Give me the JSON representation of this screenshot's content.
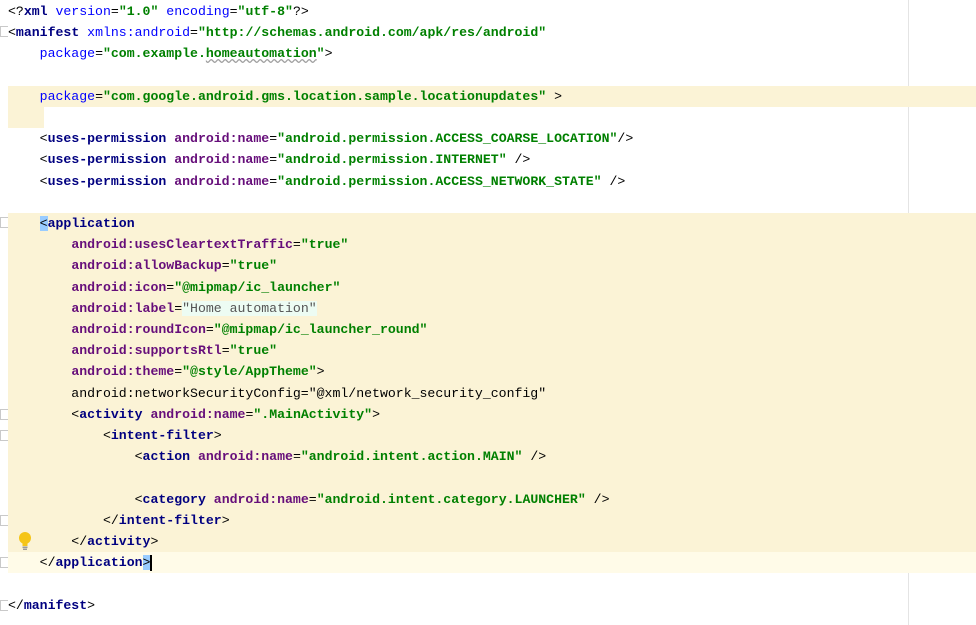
{
  "editor": {
    "lines": [
      {
        "id": "l1",
        "parts": [
          [
            "p",
            "<?"
          ],
          [
            "t",
            "xml "
          ],
          [
            "a",
            "version"
          ],
          [
            "p",
            "="
          ],
          [
            "v",
            "\"1.0\" "
          ],
          [
            "a",
            "encoding"
          ],
          [
            "p",
            "="
          ],
          [
            "v",
            "\"utf-8\""
          ],
          [
            "p",
            "?>"
          ]
        ]
      },
      {
        "id": "l2",
        "parts": [
          [
            "p",
            "<"
          ],
          [
            "t",
            "manifest "
          ],
          [
            "a",
            "xmlns:"
          ],
          [
            "a",
            "android"
          ],
          [
            "p",
            "="
          ],
          [
            "v",
            "\"http://schemas.android.com/apk/res/android\""
          ]
        ]
      },
      {
        "id": "l3",
        "parts": [
          [
            "p",
            "    "
          ],
          [
            "a",
            "package"
          ],
          [
            "p",
            "="
          ],
          [
            "v",
            "\"com.example."
          ],
          [
            "v",
            "homeautomation"
          ],
          [
            "v",
            "\""
          ],
          [
            "p",
            ">"
          ]
        ]
      },
      {
        "id": "l4",
        "parts": []
      },
      {
        "id": "l5",
        "parts": [
          [
            "p",
            "    "
          ],
          [
            "a",
            "package"
          ],
          [
            "p",
            "="
          ],
          [
            "v",
            "\"com.google.android.gms.location.sample."
          ],
          [
            "v",
            "locationupdates"
          ],
          [
            "v",
            "\""
          ],
          [
            "p",
            " >"
          ]
        ]
      },
      {
        "id": "l6",
        "parts": []
      },
      {
        "id": "l7",
        "parts": [
          [
            "p",
            "    <"
          ],
          [
            "t",
            "uses-permission "
          ],
          [
            "aa",
            "android"
          ],
          [
            "an",
            ":name"
          ],
          [
            "p",
            "="
          ],
          [
            "v",
            "\"android.permission.ACCESS_COARSE_LOCATION\""
          ],
          [
            "p",
            "/>"
          ]
        ]
      },
      {
        "id": "l8",
        "parts": [
          [
            "p",
            "    <"
          ],
          [
            "t",
            "uses-permission "
          ],
          [
            "aa",
            "android"
          ],
          [
            "an",
            ":name"
          ],
          [
            "p",
            "="
          ],
          [
            "v",
            "\"android.permission.INTERNET\""
          ],
          [
            "p",
            " />"
          ]
        ]
      },
      {
        "id": "l9",
        "parts": [
          [
            "p",
            "    <"
          ],
          [
            "t",
            "uses-permission "
          ],
          [
            "aa",
            "android"
          ],
          [
            "an",
            ":name"
          ],
          [
            "p",
            "="
          ],
          [
            "v",
            "\"android.permission.ACCESS_NETWORK_STATE\""
          ],
          [
            "p",
            " />"
          ]
        ]
      },
      {
        "id": "l10",
        "parts": []
      },
      {
        "id": "l11",
        "parts": [
          [
            "p",
            "    "
          ],
          [
            "b",
            "<"
          ],
          [
            "t",
            "application"
          ]
        ]
      },
      {
        "id": "l12",
        "parts": [
          [
            "p",
            "        "
          ],
          [
            "aa",
            "android"
          ],
          [
            "an",
            ":usesCleartextTraffic"
          ],
          [
            "p",
            "="
          ],
          [
            "v",
            "\"true\""
          ]
        ]
      },
      {
        "id": "l13",
        "parts": [
          [
            "p",
            "        "
          ],
          [
            "aa",
            "android"
          ],
          [
            "an",
            ":allowBackup"
          ],
          [
            "p",
            "="
          ],
          [
            "v",
            "\"true\""
          ]
        ]
      },
      {
        "id": "l14",
        "parts": [
          [
            "p",
            "        "
          ],
          [
            "aa",
            "android"
          ],
          [
            "an",
            ":icon"
          ],
          [
            "p",
            "="
          ],
          [
            "v",
            "\"@mipmap/ic_launcher\""
          ]
        ]
      },
      {
        "id": "l15",
        "parts": [
          [
            "p",
            "        "
          ],
          [
            "aa",
            "android"
          ],
          [
            "an",
            ":label"
          ],
          [
            "p",
            "="
          ],
          [
            "l",
            "\"Home automation\""
          ]
        ]
      },
      {
        "id": "l16",
        "parts": [
          [
            "p",
            "        "
          ],
          [
            "aa",
            "android"
          ],
          [
            "an",
            ":roundIcon"
          ],
          [
            "p",
            "="
          ],
          [
            "v",
            "\"@mipmap/ic_launcher_round\""
          ]
        ]
      },
      {
        "id": "l17",
        "parts": [
          [
            "p",
            "        "
          ],
          [
            "aa",
            "android"
          ],
          [
            "an",
            ":supportsRtl"
          ],
          [
            "p",
            "="
          ],
          [
            "v",
            "\"true\""
          ]
        ]
      },
      {
        "id": "l18",
        "parts": [
          [
            "p",
            "        "
          ],
          [
            "aa",
            "android"
          ],
          [
            "an",
            ":theme"
          ],
          [
            "p",
            "="
          ],
          [
            "v",
            "\"@style/AppTheme\""
          ],
          [
            "p",
            ">"
          ]
        ]
      },
      {
        "id": "l19",
        "parts": [
          [
            "p",
            "        android:networkSecurityConfig=\"@xml/network_security_config\""
          ]
        ]
      },
      {
        "id": "l20",
        "parts": [
          [
            "p",
            "        <"
          ],
          [
            "t",
            "activity "
          ],
          [
            "aa",
            "android"
          ],
          [
            "an",
            ":name"
          ],
          [
            "p",
            "="
          ],
          [
            "v",
            "\".MainActivity\""
          ],
          [
            "p",
            ">"
          ]
        ]
      },
      {
        "id": "l21",
        "parts": [
          [
            "p",
            "            <"
          ],
          [
            "t",
            "intent-filter"
          ],
          [
            "p",
            ">"
          ]
        ]
      },
      {
        "id": "l22",
        "parts": [
          [
            "p",
            "                <"
          ],
          [
            "t",
            "action "
          ],
          [
            "aa",
            "android"
          ],
          [
            "an",
            ":name"
          ],
          [
            "p",
            "="
          ],
          [
            "v",
            "\"android.intent.action.MAIN\""
          ],
          [
            "p",
            " />"
          ]
        ]
      },
      {
        "id": "l23",
        "parts": []
      },
      {
        "id": "l24",
        "parts": [
          [
            "p",
            "                <"
          ],
          [
            "t",
            "category "
          ],
          [
            "aa",
            "android"
          ],
          [
            "an",
            ":name"
          ],
          [
            "p",
            "="
          ],
          [
            "v",
            "\"android.intent.category.LAUNCHER\""
          ],
          [
            "p",
            " />"
          ]
        ]
      },
      {
        "id": "l25",
        "parts": [
          [
            "p",
            "            </"
          ],
          [
            "t",
            "intent-filter"
          ],
          [
            "p",
            ">"
          ]
        ]
      },
      {
        "id": "l26",
        "parts": [
          [
            "p",
            "        </"
          ],
          [
            "t",
            "activity"
          ],
          [
            "p",
            ">"
          ]
        ]
      },
      {
        "id": "l27",
        "parts": [
          [
            "p",
            "    </"
          ],
          [
            "t",
            "application"
          ],
          [
            "b",
            ">"
          ],
          [
            "c",
            ""
          ]
        ]
      },
      {
        "id": "l28",
        "parts": []
      },
      {
        "id": "l29",
        "parts": [
          [
            "p",
            "</"
          ],
          [
            "t",
            "manifest"
          ],
          [
            "p",
            ">"
          ]
        ]
      }
    ],
    "highlighted_lines": [
      "l5",
      "l11",
      "l12",
      "l13",
      "l14",
      "l15",
      "l16",
      "l17",
      "l18",
      "l19",
      "l20",
      "l21",
      "l22",
      "l23",
      "l24",
      "l25",
      "l26"
    ],
    "partial_highlight_lines": [
      "l6"
    ],
    "caret_line": "l27",
    "intention_icon": "lightbulb-icon",
    "colors": {
      "tag": "#000080",
      "attribute": "#0000ff",
      "android_attr": "#660e7a",
      "value": "#008000",
      "line_highlight": "#fbf3d6",
      "brace_match": "#99ccff"
    }
  }
}
